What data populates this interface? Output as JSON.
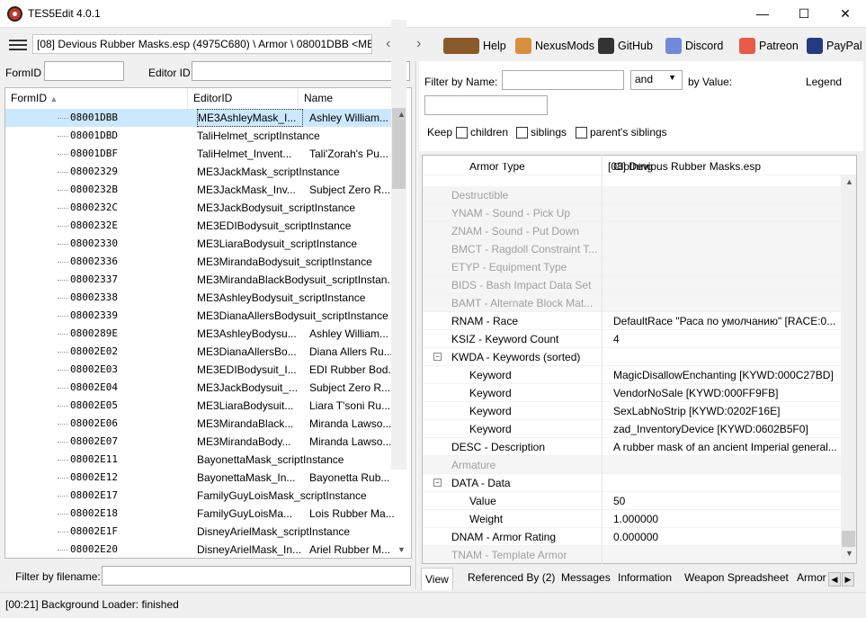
{
  "window": {
    "title": "TES5Edit 4.0.1",
    "minimize": "—",
    "maximize": "☐",
    "close": "✕"
  },
  "toolbar": {
    "path": "[08] Devious Rubber Masks.esp (4975C680) \\ Armor \\ 08001DBB <ME3A",
    "back": "‹",
    "forward": "›",
    "buttons": [
      {
        "label": "Help",
        "icon": "book-icon",
        "color": "#8b5a2b"
      },
      {
        "label": "NexusMods",
        "icon": "nexusmods-icon",
        "color": "#d98f40"
      },
      {
        "label": "GitHub",
        "icon": "github-icon",
        "color": "#333333"
      },
      {
        "label": "Discord",
        "icon": "discord-icon",
        "color": "#7289da"
      },
      {
        "label": "Patreon",
        "icon": "patreon-icon",
        "color": "#e85b46"
      },
      {
        "label": "PayPal",
        "icon": "paypal-icon",
        "color": "#253b80"
      }
    ]
  },
  "left": {
    "formid_label": "FormID",
    "editorid_label": "Editor ID",
    "columns": [
      "FormID",
      "EditorID",
      "Name"
    ],
    "rows": [
      {
        "id": "08001DBB",
        "editor": "ME3AshleyMask_I...",
        "name": "Ashley William...",
        "sel": true
      },
      {
        "id": "08001DBD",
        "editor": "TaliHelmet_scriptInstance",
        "name": ""
      },
      {
        "id": "08001DBF",
        "editor": "TaliHelmet_Invent...",
        "name": "Tali'Zorah's Pu..."
      },
      {
        "id": "08002329",
        "editor": "ME3JackMask_scriptInstance",
        "name": ""
      },
      {
        "id": "0800232B",
        "editor": "ME3JackMask_Inv...",
        "name": "Subject Zero R..."
      },
      {
        "id": "0800232C",
        "editor": "ME3JackBodysuit_scriptInstance",
        "name": ""
      },
      {
        "id": "0800232E",
        "editor": "ME3EDIBodysuit_scriptInstance",
        "name": ""
      },
      {
        "id": "08002330",
        "editor": "ME3LiaraBodysuit_scriptInstance",
        "name": ""
      },
      {
        "id": "08002336",
        "editor": "ME3MirandaBodysuit_scriptInstance",
        "name": ""
      },
      {
        "id": "08002337",
        "editor": "ME3MirandaBlackBodysuit_scriptInstan...",
        "name": ""
      },
      {
        "id": "08002338",
        "editor": "ME3AshleyBodysuit_scriptInstance",
        "name": ""
      },
      {
        "id": "08002339",
        "editor": "ME3DianaAllersBodysuit_scriptInstance",
        "name": ""
      },
      {
        "id": "0800289E",
        "editor": "ME3AshleyBodysu...",
        "name": "Ashley William..."
      },
      {
        "id": "08002E02",
        "editor": "ME3DianaAllersBo...",
        "name": "Diana Allers Ru..."
      },
      {
        "id": "08002E03",
        "editor": "ME3EDIBodysuit_I...",
        "name": "EDI Rubber Bod..."
      },
      {
        "id": "08002E04",
        "editor": "ME3JackBodysuit_...",
        "name": "Subject Zero R..."
      },
      {
        "id": "08002E05",
        "editor": "ME3LiaraBodysuit...",
        "name": "Liara T'soni Ru..."
      },
      {
        "id": "08002E06",
        "editor": "ME3MirandaBlack...",
        "name": "Miranda Lawso..."
      },
      {
        "id": "08002E07",
        "editor": "ME3MirandaBody...",
        "name": "Miranda Lawso..."
      },
      {
        "id": "08002E11",
        "editor": "BayonettaMask_scriptInstance",
        "name": ""
      },
      {
        "id": "08002E12",
        "editor": "BayonettaMask_In...",
        "name": "Bayonetta Rub..."
      },
      {
        "id": "08002E17",
        "editor": "FamilyGuyLoisMask_scriptInstance",
        "name": ""
      },
      {
        "id": "08002E18",
        "editor": "FamilyGuyLoisMa...",
        "name": "Lois Rubber Ma..."
      },
      {
        "id": "08002E1F",
        "editor": "DisneyArielMask_scriptInstance",
        "name": ""
      },
      {
        "id": "08002E20",
        "editor": "DisneyArielMask_In...",
        "name": "Ariel Rubber M..."
      }
    ],
    "filter_file_label": "Filter by filename:"
  },
  "right": {
    "filter_name_label": "Filter by Name:",
    "and_value": "and",
    "by_value_label": "by Value:",
    "legend": "Legend",
    "keep_label": "Keep",
    "keep_options": [
      "children",
      "siblings",
      "parent's siblings"
    ],
    "column_header": "[08] Devious Rubber Masks.esp",
    "records": [
      {
        "name": "Armor Type",
        "value": "Clothing",
        "indent": 1,
        "grey": false,
        "partial": true
      },
      {
        "name": "Destructible",
        "value": "",
        "indent": 0,
        "grey": true
      },
      {
        "name": "YNAM - Sound - Pick Up",
        "value": "",
        "indent": 0,
        "grey": true
      },
      {
        "name": "ZNAM - Sound - Put Down",
        "value": "",
        "indent": 0,
        "grey": true
      },
      {
        "name": "BMCT - Ragdoll Constraint T...",
        "value": "",
        "indent": 0,
        "grey": true
      },
      {
        "name": "ETYP - Equipment Type",
        "value": "",
        "indent": 0,
        "grey": true
      },
      {
        "name": "BIDS - Bash Impact Data Set",
        "value": "",
        "indent": 0,
        "grey": true
      },
      {
        "name": "BAMT - Alternate Block Mat...",
        "value": "",
        "indent": 0,
        "grey": true
      },
      {
        "name": "RNAM - Race",
        "value": "DefaultRace \"Раса по умолчанию\" [RACE:0...",
        "indent": 0,
        "grey": false
      },
      {
        "name": "KSIZ - Keyword Count",
        "value": "4",
        "indent": 0,
        "grey": false
      },
      {
        "name": "KWDA - Keywords (sorted)",
        "value": "",
        "indent": 0,
        "grey": false,
        "expand": "−"
      },
      {
        "name": "Keyword",
        "value": "MagicDisallowEnchanting [KYWD:000C27BD]",
        "indent": 1,
        "grey": false
      },
      {
        "name": "Keyword",
        "value": "VendorNoSale [KYWD:000FF9FB]",
        "indent": 1,
        "grey": false
      },
      {
        "name": "Keyword",
        "value": "SexLabNoStrip [KYWD:0202F16E]",
        "indent": 1,
        "grey": false
      },
      {
        "name": "Keyword",
        "value": "zad_InventoryDevice [KYWD:0602B5F0]",
        "indent": 1,
        "grey": false
      },
      {
        "name": "DESC - Description",
        "value": "A rubber mask of an ancient Imperial general...",
        "indent": 0,
        "grey": false
      },
      {
        "name": "Armature",
        "value": "",
        "indent": 0,
        "grey": true
      },
      {
        "name": "DATA - Data",
        "value": "",
        "indent": 0,
        "grey": false,
        "expand": "−"
      },
      {
        "name": "Value",
        "value": "50",
        "indent": 1,
        "grey": false
      },
      {
        "name": "Weight",
        "value": "1.000000",
        "indent": 1,
        "grey": false
      },
      {
        "name": "DNAM - Armor Rating",
        "value": "0.000000",
        "indent": 0,
        "grey": false
      },
      {
        "name": "TNAM - Template Armor",
        "value": "",
        "indent": 0,
        "grey": true
      }
    ],
    "tabs": [
      "View",
      "Referenced By (2)",
      "Messages",
      "Information",
      "Weapon Spreadsheet",
      "Armor"
    ]
  },
  "status": "[00:21] Background Loader: finished"
}
